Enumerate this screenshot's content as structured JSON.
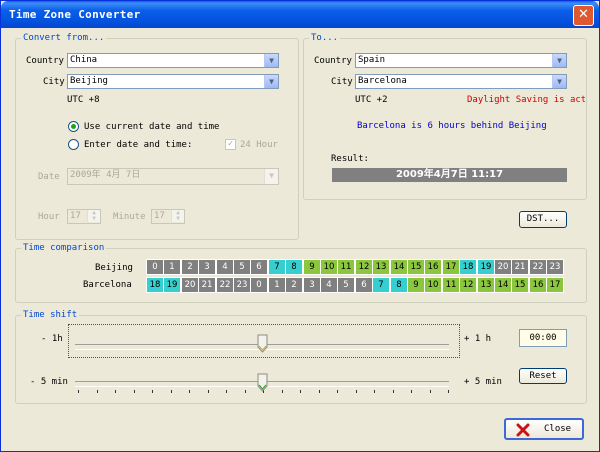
{
  "window": {
    "title": "Time Zone Converter"
  },
  "from": {
    "legend": "Convert from...",
    "country_label": "Country",
    "country_value": "China",
    "city_label": "City",
    "city_value": "Beijing",
    "utc": "UTC +8",
    "radio_current": "Use current date and time",
    "radio_enter": "Enter date and time:",
    "hour24_label": "24 Hour",
    "date_label": "Date",
    "date_value": "2009年 4月 7日",
    "hour_label": "Hour",
    "hour_value": "17",
    "minute_label": "Minute",
    "minute_value": "17"
  },
  "to": {
    "legend": "To...",
    "country_label": "Country",
    "country_value": "Spain",
    "city_label": "City",
    "city_value": "Barcelona",
    "utc": "UTC +2",
    "dst_notice": "Daylight Saving is acti",
    "diff_text": "Barcelona is 6 hours behind Beijing",
    "result_label": "Result:",
    "result_value": "2009年4月7日 11:17"
  },
  "dst_button": "DST...",
  "comparison": {
    "legend": "Time comparison",
    "row1_label": "Beijing",
    "row2_label": "Barcelona",
    "row1": [
      0,
      1,
      2,
      3,
      4,
      5,
      6,
      7,
      8,
      9,
      10,
      11,
      12,
      13,
      14,
      15,
      16,
      17,
      18,
      19,
      20,
      21,
      22,
      23
    ],
    "row2": [
      18,
      19,
      20,
      21,
      22,
      23,
      0,
      1,
      2,
      3,
      4,
      5,
      6,
      7,
      8,
      9,
      10,
      11,
      12,
      13,
      14,
      15,
      16,
      17
    ],
    "row1_colors": [
      "dark",
      "dark",
      "dark",
      "dark",
      "dark",
      "dark",
      "dark",
      "cyan",
      "cyan",
      "green",
      "green",
      "green",
      "green",
      "green",
      "green",
      "green",
      "green",
      "green",
      "cyan",
      "cyan",
      "dark",
      "dark",
      "dark",
      "dark"
    ],
    "row2_colors": [
      "cyan",
      "cyan",
      "dark",
      "dark",
      "dark",
      "dark",
      "dark",
      "dark",
      "dark",
      "dark",
      "dark",
      "dark",
      "dark",
      "cyan",
      "cyan",
      "green",
      "green",
      "green",
      "green",
      "green",
      "green",
      "green",
      "green",
      "green"
    ]
  },
  "shift": {
    "legend": "Time shift",
    "hour_left": "- 1h",
    "hour_right": "+ 1 h",
    "min_left": "- 5 min",
    "min_right": "+ 5 min",
    "time_value": "00:00",
    "reset_label": "Reset"
  },
  "close_label": "Close",
  "colors": {
    "accent": "#0046d5",
    "dark": "#808080",
    "cyan": "#36cfcf",
    "green": "#8cc63f",
    "dst": "#cc0000",
    "diff": "#0000cc"
  }
}
